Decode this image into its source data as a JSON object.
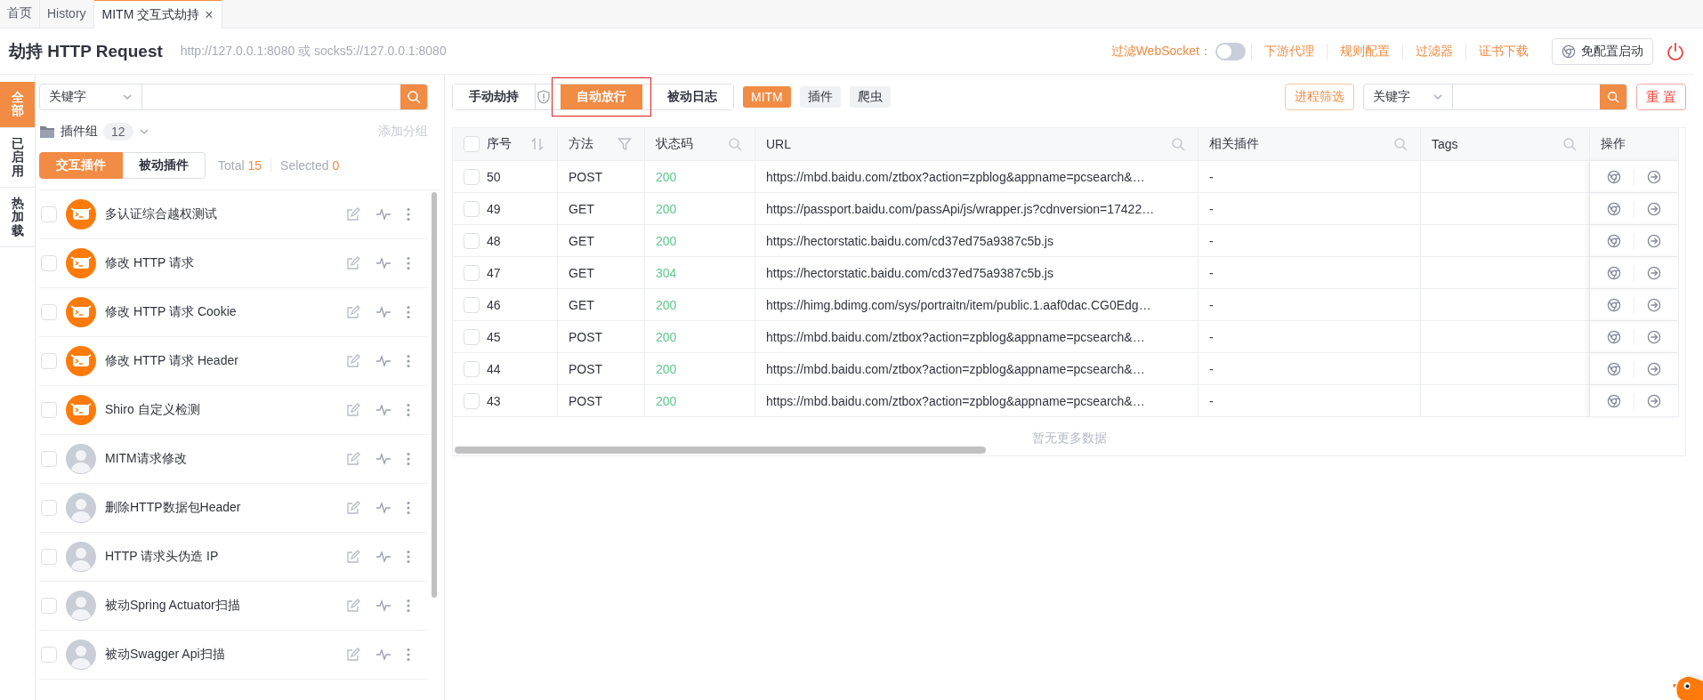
{
  "tabs": [
    {
      "label": "首页",
      "selected": false
    },
    {
      "label": "History",
      "selected": false
    },
    {
      "label": "MITM 交互式劫持",
      "selected": true,
      "close": "×"
    }
  ],
  "header": {
    "title": "劫持 HTTP Request",
    "address": "http://127.0.0.1:8080 或 socks5://127.0.0.1:8080",
    "filter_websocket": {
      "label": "过滤WebSocket：",
      "on": false
    },
    "links": [
      "下游代理",
      "规则配置",
      "过滤器",
      "证书下载"
    ],
    "launch_button": "免配置启动"
  },
  "side_tabs": [
    {
      "label": "全部",
      "selected": true
    },
    {
      "label": "已启用",
      "selected": false
    },
    {
      "label": "热加载",
      "selected": false
    }
  ],
  "plugin_search": {
    "type": "关键字"
  },
  "plugin_group": {
    "label": "插件组",
    "count": "12",
    "add_label": "添加分组"
  },
  "plugin_tabs": [
    {
      "label": "交互插件",
      "selected": true
    },
    {
      "label": "被动插件",
      "selected": false
    }
  ],
  "total": {
    "label": "Total",
    "value": "15"
  },
  "selected_count": {
    "label": "Selected",
    "value": "0"
  },
  "plugins": [
    {
      "name": "多认证综合越权测试",
      "kind": "bot",
      "checked": false
    },
    {
      "name": "修改 HTTP 请求",
      "kind": "bot",
      "checked": false
    },
    {
      "name": "修改 HTTP 请求 Cookie",
      "kind": "bot",
      "checked": false
    },
    {
      "name": "修改 HTTP 请求 Header",
      "kind": "bot",
      "checked": false
    },
    {
      "name": "Shiro 自定义检测",
      "kind": "bot",
      "checked": false
    },
    {
      "name": "MITM请求修改",
      "kind": "image",
      "checked": false
    },
    {
      "name": "删除HTTP数据包Header",
      "kind": "image",
      "checked": false
    },
    {
      "name": "HTTP 请求头伪造 IP",
      "kind": "image",
      "checked": false
    },
    {
      "name": "被动Spring Actuator扫描",
      "kind": "image",
      "checked": false
    },
    {
      "name": "被动Swagger Api扫描",
      "kind": "image",
      "checked": false
    }
  ],
  "mode_tabs": [
    {
      "label": "手动劫持",
      "selected": false,
      "annotated": false
    },
    {
      "label": "自动放行",
      "selected": true,
      "annotated": true
    },
    {
      "label": "被动日志",
      "selected": false,
      "annotated": false
    }
  ],
  "source_tabs": [
    {
      "label": "MITM",
      "selected": true
    },
    {
      "label": "插件",
      "selected": false
    },
    {
      "label": "爬虫",
      "selected": false
    }
  ],
  "process_filter": "进程筛选",
  "search": {
    "type": "关键字"
  },
  "reset": "重 置",
  "table": {
    "all_checked": false,
    "columns": [
      {
        "label": "序号",
        "kind": "sort"
      },
      {
        "label": "方法",
        "kind": "filter"
      },
      {
        "label": "状态码",
        "kind": "search"
      },
      {
        "label": "URL",
        "kind": "search"
      },
      {
        "label": "相关插件",
        "kind": "search"
      },
      {
        "label": "Tags",
        "kind": "search"
      },
      {
        "label": "操作",
        "kind": "plain"
      }
    ],
    "rows": [
      {
        "id": "50",
        "method": "POST",
        "status": "200",
        "url": "https://mbd.baidu.com/ztbox?action=zpblog&appname=pcsearch&…",
        "plugin": "-",
        "checked": false
      },
      {
        "id": "49",
        "method": "GET",
        "status": "200",
        "url": "https://passport.baidu.com/passApi/js/wrapper.js?cdnversion=17422…",
        "plugin": "-",
        "checked": false
      },
      {
        "id": "48",
        "method": "GET",
        "status": "200",
        "url": "https://hectorstatic.baidu.com/cd37ed75a9387c5b.js",
        "plugin": "-",
        "checked": false
      },
      {
        "id": "47",
        "method": "GET",
        "status": "304",
        "url": "https://hectorstatic.baidu.com/cd37ed75a9387c5b.js",
        "plugin": "-",
        "checked": false
      },
      {
        "id": "46",
        "method": "GET",
        "status": "200",
        "url": "https://himg.bdimg.com/sys/portraitn/item/public.1.aaf0dac.CG0Edg…",
        "plugin": "-",
        "checked": false
      },
      {
        "id": "45",
        "method": "POST",
        "status": "200",
        "url": "https://mbd.baidu.com/ztbox?action=zpblog&appname=pcsearch&…",
        "plugin": "-",
        "checked": false
      },
      {
        "id": "44",
        "method": "POST",
        "status": "200",
        "url": "https://mbd.baidu.com/ztbox?action=zpblog&appname=pcsearch&…",
        "plugin": "-",
        "checked": false
      },
      {
        "id": "43",
        "method": "POST",
        "status": "200",
        "url": "https://mbd.baidu.com/ztbox?action=zpblog&appname=pcsearch&…",
        "plugin": "-",
        "checked": false
      }
    ],
    "empty_text": "暂无更多数据"
  }
}
